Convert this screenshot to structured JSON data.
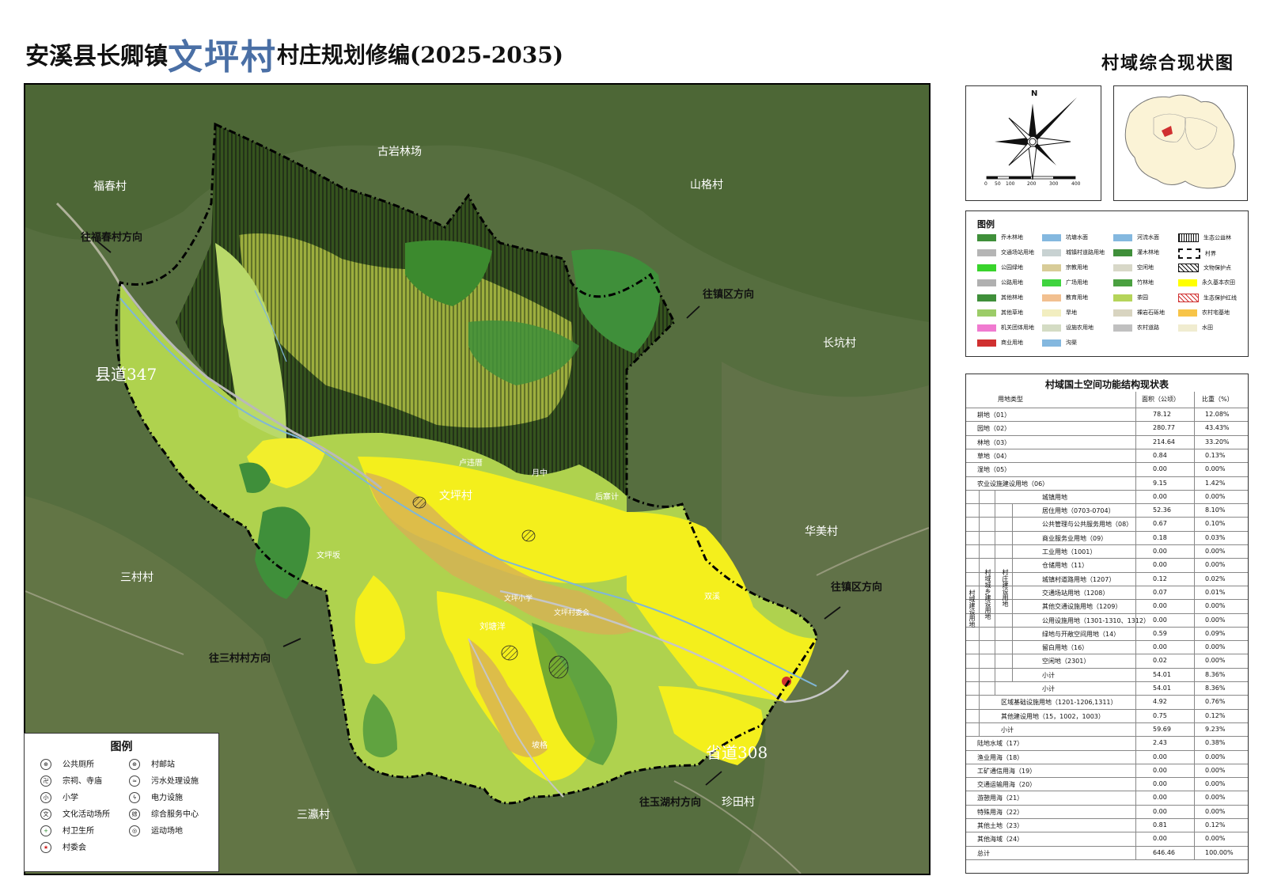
{
  "header": {
    "title_prefix": "安溪县长卿镇",
    "title_village": "文坪村",
    "title_suffix": "村庄规划修编(2025-2035)",
    "subtitle": "村域综合现状图"
  },
  "map": {
    "labels": {
      "gu_yan_lin_chang": "古岩林场",
      "fu_chun_cun": "福春村",
      "shan_ge_cun": "山格村",
      "chang_keng_cun": "长坑村",
      "hua_mei_cun": "华美村",
      "san_cun_cun": "三村村",
      "san_ying_cun": "三瀛村",
      "zhen_tian_cun": "珍田村",
      "wen_ping_cun": "文坪村",
      "lu_qian": "卢违厝",
      "yue_zhong": "月中",
      "hou_zhai": "后寨计",
      "wen_ping_ban": "文坪坂",
      "liu_tang_yang": "刘塘洋",
      "shuang_xi": "双溪",
      "bo_lu": "坡格",
      "wen_ping_xiao_xue": "文坪小学",
      "wen_ping_cun_wei": "文坪村委会"
    },
    "roads": {
      "county_road": "县道347",
      "provincial_road": "省道308"
    },
    "directions": {
      "to_fuchun": "往福春村方向",
      "to_town_north": "往镇区方向",
      "to_town_east": "往镇区方向",
      "to_sancun": "往三村村方向",
      "to_yuhu": "往玉湖村方向"
    }
  },
  "compass": {
    "north": "N",
    "scale_ticks": [
      "0",
      "50",
      "100",
      "200",
      "300",
      "400"
    ]
  },
  "land_legend": {
    "title": "图例",
    "items": [
      {
        "label": "乔木林地",
        "color": "#3f8f3a"
      },
      {
        "label": "坑塘水面",
        "color": "#84b8df"
      },
      {
        "label": "河流水面",
        "color": "#84b8df"
      },
      {
        "label": "生态公益林",
        "color": "pattern-vline"
      },
      {
        "label": "交通场站用地",
        "color": "#b5b5b5"
      },
      {
        "label": "城镇村道路用地",
        "color": "#c8d2d2"
      },
      {
        "label": "灌木林地",
        "color": "#3f8f3a"
      },
      {
        "label": "村界",
        "color": "boundary"
      },
      {
        "label": "公园绿地",
        "color": "#39d42c"
      },
      {
        "label": "宗教用地",
        "color": "#d8cc98"
      },
      {
        "label": "空闲地",
        "color": "#d8d8c8"
      },
      {
        "label": "文物保护点",
        "color": "pattern-hatch"
      },
      {
        "label": "公路用地",
        "color": "#b0b0b0"
      },
      {
        "label": "广场用地",
        "color": "#3fd43f"
      },
      {
        "label": "竹林地",
        "color": "#4aa040"
      },
      {
        "label": "永久基本农田",
        "color": "#ffff00"
      },
      {
        "label": "其他林地",
        "color": "#3f8f3a"
      },
      {
        "label": "教育用地",
        "color": "#f2c090"
      },
      {
        "label": "茶园",
        "color": "#b5d45a"
      },
      {
        "label": "生态保护红线",
        "color": "pattern-red"
      },
      {
        "label": "其他草地",
        "color": "#9ccc68"
      },
      {
        "label": "旱地",
        "color": "#f2eec0"
      },
      {
        "label": "裸岩石砾地",
        "color": "#d8d4c0"
      },
      {
        "label": "农村宅基地",
        "color": "#f7c448"
      },
      {
        "label": "机关团体用地",
        "color": "#f07ad0"
      },
      {
        "label": "设施农用地",
        "color": "#d4dcc4"
      },
      {
        "label": "农村道路",
        "color": "#c0c0c0"
      },
      {
        "label": "水田",
        "color": "#f0ecd0"
      },
      {
        "label": "商业用地",
        "color": "#d03030"
      },
      {
        "label": "沟渠",
        "color": "#84b8df"
      }
    ]
  },
  "table": {
    "title": "村域国土空间功能结构现状表",
    "headers": [
      "用地类型",
      "面积（公顷）",
      "比重（%）"
    ],
    "group_labels": [
      "村域建设用地",
      "村域城乡建设用地",
      "村庄建设用地"
    ],
    "rows": [
      {
        "name": "耕地（01）",
        "area": "78.12",
        "pct": "12.08%"
      },
      {
        "name": "园地（02）",
        "area": "280.77",
        "pct": "43.43%"
      },
      {
        "name": "林地（03）",
        "area": "214.64",
        "pct": "33.20%"
      },
      {
        "name": "草地（04）",
        "area": "0.84",
        "pct": "0.13%"
      },
      {
        "name": "湿地（05）",
        "area": "0.00",
        "pct": "0.00%"
      },
      {
        "name": "农业设施建设用地（06）",
        "area": "9.15",
        "pct": "1.42%"
      },
      {
        "name": "城镇用地",
        "area": "0.00",
        "pct": "0.00%"
      },
      {
        "name": "居住用地（0703-0704）",
        "area": "52.36",
        "pct": "8.10%"
      },
      {
        "name": "公共管理与公共服务用地（08）",
        "area": "0.67",
        "pct": "0.10%"
      },
      {
        "name": "商业服务业用地（09）",
        "area": "0.18",
        "pct": "0.03%"
      },
      {
        "name": "工业用地（1001）",
        "area": "0.00",
        "pct": "0.00%"
      },
      {
        "name": "仓储用地（11）",
        "area": "0.00",
        "pct": "0.00%"
      },
      {
        "name": "城镇村道路用地（1207）",
        "area": "0.12",
        "pct": "0.02%"
      },
      {
        "name": "交通场站用地（1208）",
        "area": "0.07",
        "pct": "0.01%"
      },
      {
        "name": "其他交通设施用地（1209）",
        "area": "0.00",
        "pct": "0.00%"
      },
      {
        "name": "公用设施用地（1301-1310、1312）",
        "area": "0.00",
        "pct": "0.00%"
      },
      {
        "name": "绿地与开敞空间用地（14）",
        "area": "0.59",
        "pct": "0.09%"
      },
      {
        "name": "留白用地（16）",
        "area": "0.00",
        "pct": "0.00%"
      },
      {
        "name": "空闲地（2301）",
        "area": "0.02",
        "pct": "0.00%"
      },
      {
        "name": "小计",
        "area": "54.01",
        "pct": "8.36%"
      },
      {
        "name": "小计",
        "area": "54.01",
        "pct": "8.36%"
      },
      {
        "name": "区域基础设施用地（1201-1206,1311）",
        "area": "4.92",
        "pct": "0.76%"
      },
      {
        "name": "其他建设用地（15，1002，1003）",
        "area": "0.75",
        "pct": "0.12%"
      },
      {
        "name": "小计",
        "area": "59.69",
        "pct": "9.23%"
      },
      {
        "name": "陆地水域（17）",
        "area": "2.43",
        "pct": "0.38%"
      },
      {
        "name": "渔业用海（18）",
        "area": "0.00",
        "pct": "0.00%"
      },
      {
        "name": "工矿通信用海（19）",
        "area": "0.00",
        "pct": "0.00%"
      },
      {
        "name": "交通运输用海（20）",
        "area": "0.00",
        "pct": "0.00%"
      },
      {
        "name": "游憩用海（21）",
        "area": "0.00",
        "pct": "0.00%"
      },
      {
        "name": "特殊用海（22）",
        "area": "0.00",
        "pct": "0.00%"
      },
      {
        "name": "其他土地（23）",
        "area": "0.81",
        "pct": "0.12%"
      },
      {
        "name": "其他海域（24）",
        "area": "0.00",
        "pct": "0.00%"
      },
      {
        "name": "总计",
        "area": "646.46",
        "pct": "100.00%"
      }
    ]
  },
  "facility_legend": {
    "title": "图例",
    "items": [
      {
        "label": "公共厕所",
        "icon": "toilet-icon",
        "glyph": "⊕"
      },
      {
        "label": "村邮站",
        "icon": "post-icon",
        "glyph": "⊕"
      },
      {
        "label": "宗祠、寺庙",
        "icon": "temple-icon",
        "glyph": "卍"
      },
      {
        "label": "污水处理设施",
        "icon": "sewage-icon",
        "glyph": "≈"
      },
      {
        "label": "小学",
        "icon": "school-icon",
        "glyph": "小"
      },
      {
        "label": "电力设施",
        "icon": "power-icon",
        "glyph": "ϟ"
      },
      {
        "label": "文化活动场所",
        "icon": "culture-icon",
        "glyph": "文"
      },
      {
        "label": "综合服务中心",
        "icon": "service-icon",
        "glyph": "综"
      },
      {
        "label": "村卫生所",
        "icon": "clinic-icon",
        "glyph": "+"
      },
      {
        "label": "运动场地",
        "icon": "sports-icon",
        "glyph": "◎"
      },
      {
        "label": "村委会",
        "icon": "committee-icon",
        "glyph": "★"
      }
    ]
  }
}
